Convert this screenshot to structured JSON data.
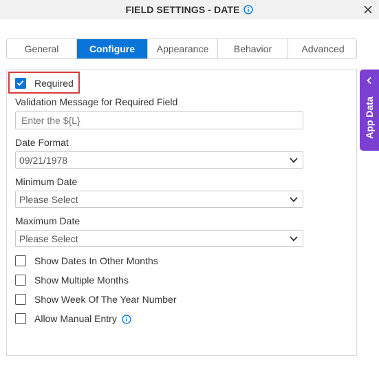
{
  "header": {
    "title": "FIELD SETTINGS - DATE"
  },
  "tabs": [
    {
      "label": "General",
      "active": false
    },
    {
      "label": "Configure",
      "active": true
    },
    {
      "label": "Appearance",
      "active": false
    },
    {
      "label": "Behavior",
      "active": false
    },
    {
      "label": "Advanced",
      "active": false
    }
  ],
  "required": {
    "label": "Required",
    "checked": true
  },
  "validation_message": {
    "label": "Validation Message for Required Field",
    "placeholder": "Enter the ${L}",
    "value": ""
  },
  "date_format": {
    "label": "Date Format",
    "value": "09/21/1978"
  },
  "minimum_date": {
    "label": "Minimum Date",
    "value": "Please Select"
  },
  "maximum_date": {
    "label": "Maximum Date",
    "value": "Please Select"
  },
  "options": [
    {
      "label": "Show Dates In Other Months",
      "checked": false
    },
    {
      "label": "Show Multiple Months",
      "checked": false
    },
    {
      "label": "Show Week Of The Year Number",
      "checked": false
    },
    {
      "label": "Allow Manual Entry",
      "checked": false
    }
  ],
  "app_data": {
    "label": "App Data"
  },
  "colors": {
    "accent": "#0a74d9",
    "app_data_tab": "#7b3fd1",
    "highlight": "#d93a3a"
  }
}
